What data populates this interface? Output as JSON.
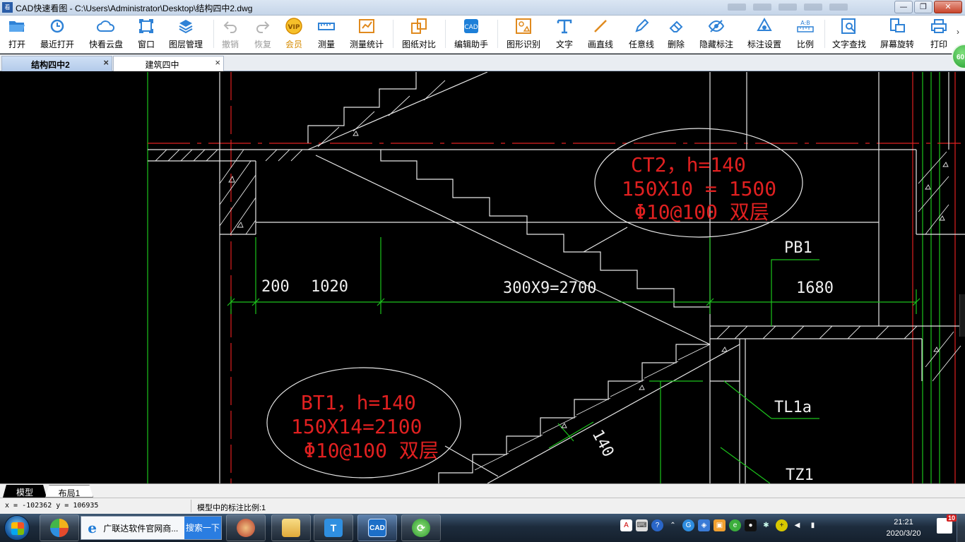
{
  "window": {
    "title": "CAD快速看图 - C:\\Users\\Administrator\\Desktop\\结构四中2.dwg",
    "icon_label": "看"
  },
  "toolbar": {
    "items": [
      {
        "label": "打开",
        "icon": "open-folder-icon"
      },
      {
        "label": "最近打开",
        "icon": "recent-clock-icon"
      },
      {
        "label": "快看云盘",
        "icon": "cloud-icon"
      },
      {
        "label": "窗口",
        "icon": "window-icon"
      },
      {
        "label": "图层管理",
        "icon": "layers-icon"
      },
      {
        "label": "撤销",
        "icon": "undo-icon",
        "disabled": true
      },
      {
        "label": "恢复",
        "icon": "redo-icon",
        "disabled": true
      },
      {
        "label": "会员",
        "icon": "vip-badge-icon",
        "vip": true,
        "badge": "VIP"
      },
      {
        "label": "测量",
        "icon": "ruler-icon"
      },
      {
        "label": "测量统计",
        "icon": "measure-stats-icon"
      },
      {
        "label": "图纸对比",
        "icon": "compare-icon"
      },
      {
        "label": "编辑助手",
        "icon": "edit-assistant-icon"
      },
      {
        "label": "图形识别",
        "icon": "shape-recognize-icon"
      },
      {
        "label": "文字",
        "icon": "text-t-icon"
      },
      {
        "label": "画直线",
        "icon": "line-icon"
      },
      {
        "label": "任意线",
        "icon": "freehand-pen-icon"
      },
      {
        "label": "删除",
        "icon": "eraser-icon"
      },
      {
        "label": "隐藏标注",
        "icon": "hide-eye-icon"
      },
      {
        "label": "标注设置",
        "icon": "annotation-settings-icon"
      },
      {
        "label": "比例",
        "icon": "scale-icon",
        "badge": "A:B"
      },
      {
        "label": "文字查找",
        "icon": "text-search-icon"
      },
      {
        "label": "屏幕旋转",
        "icon": "screen-rotate-icon"
      },
      {
        "label": "打印",
        "icon": "printer-icon"
      }
    ]
  },
  "tabs": [
    {
      "label": "结构四中2",
      "active": true
    },
    {
      "label": "建筑四中",
      "active": false
    }
  ],
  "badge_60": "60",
  "drawing": {
    "annotation_ct2": [
      "CT2，h=140",
      "150X10  = 1500",
      "Φ10@100  双层"
    ],
    "annotation_bt1": [
      "BT1，h=140",
      "150X14=2100",
      "Φ10@100  双层"
    ],
    "dims": [
      "200",
      "1020",
      "300X9=2700",
      "1680"
    ],
    "labels": {
      "pb1": "PB1",
      "tl1a": "TL1a",
      "tz1": "TZ1",
      "thickness": "140"
    },
    "colors": {
      "red": "#e02020",
      "green": "#1cc41c",
      "white": "#f0f0f0"
    }
  },
  "layout_tabs": [
    {
      "label": "模型",
      "active": true
    },
    {
      "label": "布局1",
      "active": false
    }
  ],
  "status": {
    "coords": "x = -102362  y = 106935",
    "scale_text": "模型中的标注比例:1"
  },
  "taskbar": {
    "ie_title": "广联达软件官网商...",
    "search_button": "搜索一下",
    "cad_label": "CAD",
    "time": "21:21",
    "date": "2020/3/20",
    "notification_count": "10"
  }
}
